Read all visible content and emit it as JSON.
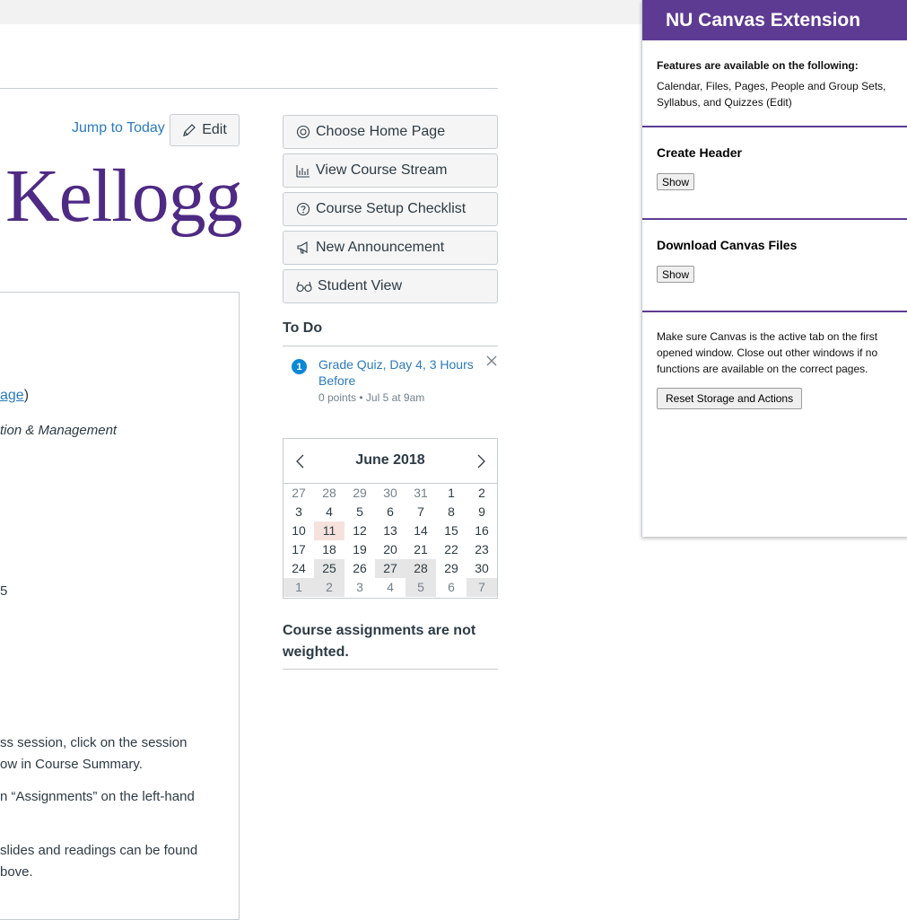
{
  "course": {
    "jump_to_today": "Jump to Today",
    "edit_label": "Edit",
    "banner_text": "Kellogg",
    "body_fragments": {
      "page_link": "age",
      "page_link_close": ")",
      "italic_line": "tion & Management",
      "number_5": "5",
      "p1_line1": "ss session, click on the session",
      "p1_line2": "ow in Course Summary.",
      "p2_line1": "n “Assignments” on the left-hand",
      "p3_line1": " slides and readings can be found",
      "p3_line2": "bove."
    }
  },
  "sidebar": {
    "buttons": [
      {
        "label": "Choose Home Page",
        "icon": "target-icon"
      },
      {
        "label": "View Course Stream",
        "icon": "stream-chart-icon"
      },
      {
        "label": "Course Setup Checklist",
        "icon": "question-icon"
      },
      {
        "label": "New Announcement",
        "icon": "megaphone-icon"
      },
      {
        "label": "Student View",
        "icon": "glasses-icon"
      }
    ],
    "todo": {
      "heading": "To Do",
      "items": [
        {
          "badge": "1",
          "title": "Grade Quiz, Day 4, 3 Hours Before",
          "meta": "0 points • Jul 5 at 9am"
        }
      ]
    },
    "calendar": {
      "month_label": "June 2018",
      "weeks": [
        [
          "27",
          "28",
          "29",
          "30",
          "31",
          "1",
          "2"
        ],
        [
          "3",
          "4",
          "5",
          "6",
          "7",
          "8",
          "9"
        ],
        [
          "10",
          "11",
          "12",
          "13",
          "14",
          "15",
          "16"
        ],
        [
          "17",
          "18",
          "19",
          "20",
          "21",
          "22",
          "23"
        ],
        [
          "24",
          "25",
          "26",
          "27",
          "28",
          "29",
          "30"
        ],
        [
          "1",
          "2",
          "3",
          "4",
          "5",
          "6",
          "7"
        ]
      ]
    },
    "weight_note": "Course assignments are not weighted."
  },
  "extension": {
    "title": "NU Canvas Extension",
    "features_heading": "Features are available on the following:",
    "features_list": "Calendar, Files, Pages, People and Group Sets, Syllabus, and Quizzes (Edit)",
    "create_header": {
      "heading": "Create Header",
      "button": "Show"
    },
    "download_files": {
      "heading": "Download Canvas Files",
      "button": "Show"
    },
    "note": "Make sure Canvas is the active tab on the first opened window. Close out other windows if no functions are available on the correct pages.",
    "reset_button": "Reset Storage and Actions"
  },
  "colors": {
    "link": "#2b7abc",
    "brand_purple": "#4e2a84",
    "extension_purple": "#5e3b93",
    "todo_badge": "#0b88d6",
    "today_highlight": "#f6e2dc"
  }
}
